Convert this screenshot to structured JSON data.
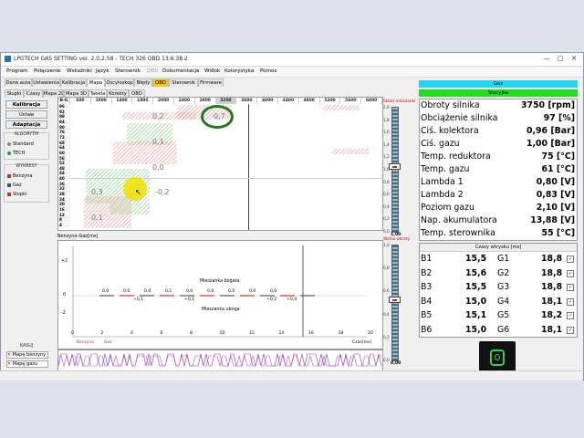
{
  "window": {
    "title": "LPGTECH GAS SETTING ver. 2.0.2.58 - TECH 326 OBD 13.6.38.2",
    "controls": [
      "—",
      "□",
      "✕"
    ]
  },
  "menu": [
    "Program",
    "Połączenie",
    "Wskaźniki",
    "Język",
    "Sterownik",
    "OBD",
    "Dokumentacja",
    "Widok",
    "Kolorystyka",
    "Pomoc"
  ],
  "tabs_top": [
    "Dane auta",
    "Ustawienia",
    "Kalibracja",
    "Mapa",
    "Oscyloskop",
    "Błędy",
    "OBD",
    "Sterownik",
    "Firmware"
  ],
  "tabs_sub": [
    "Słupki",
    "Czasy",
    "Mapa 2D",
    "Mapa 3D",
    "Tabela",
    "Korekty",
    "OBD"
  ],
  "left": {
    "buttons": [
      "Kalibracja",
      "Ustaw",
      "Adaptacja"
    ],
    "algorytm": {
      "caption": "ALGORYTM",
      "options": [
        "Standard",
        "TECH"
      ]
    },
    "wykresy": {
      "caption": "WYKRESY",
      "options": [
        "Benzyna",
        "Gaz",
        "Słupki"
      ]
    },
    "kasuj": {
      "caption": "KASUJ",
      "options": [
        "Mapę benzyny",
        "Mapę gazu"
      ]
    }
  },
  "map": {
    "corner": "B-G",
    "columns": [
      "600",
      "1000",
      "1400",
      "1800",
      "2000",
      "2400",
      "2800",
      "3200",
      "3600",
      "4000",
      "4400",
      "4800",
      "5200",
      "5600",
      "6000"
    ],
    "rows": [
      "96",
      "92",
      "88",
      "84",
      "80",
      "76",
      "72",
      "68",
      "64",
      "60",
      "56",
      "52",
      "48",
      "44",
      "40",
      "36",
      "32",
      "28",
      "24",
      "20",
      "16",
      "12",
      "8",
      "4"
    ],
    "values": [
      "0,2",
      "0,7",
      "0,1",
      "0,0",
      "0,3",
      "-0,2",
      "0,1"
    ]
  },
  "slider1": {
    "caption": "Skład mieszanki",
    "ticks": [
      "2,0",
      "1,8",
      "1,6",
      "1,4",
      "1,2",
      "1,0",
      "0,8",
      "0,6",
      "0,4",
      "0,2",
      "0,0"
    ],
    "value": "1,00"
  },
  "slider2": {
    "caption": "Wolne obroty",
    "ticks": [
      "1,0",
      "0,8",
      "0,6",
      "0,4",
      "0,2",
      "0,0"
    ],
    "value": "0,00"
  },
  "graph": {
    "title": "Benzyna-Gaz[ms]",
    "yticks": [
      "+2",
      "0",
      "-2"
    ],
    "xticks": [
      "0",
      "2",
      "4",
      "6",
      "8",
      "10",
      "12",
      "14",
      "16",
      "18",
      "20"
    ],
    "xlabel": "Czas[ms]",
    "rich": "Mieszanka bogata",
    "lean": "Mieszanka uboga",
    "labels_top": [
      "0,0",
      "0,0",
      "0,0",
      "0,1",
      "0,0",
      "0,0",
      "0,0",
      "0,0",
      "0,0"
    ],
    "labels_bot": [
      "+0,1",
      "+0,1",
      "+0,2",
      "+0,4"
    ],
    "legend": [
      "Benzyna",
      "Gaz"
    ]
  },
  "right": {
    "gaz_label": "Gaz",
    "status_label": "Stacyjka",
    "params": [
      {
        "label": "Obroty silnika",
        "value": "3750 [rpm]"
      },
      {
        "label": "Obciążenie silnika",
        "value": "97 [%]"
      },
      {
        "label": "Ciś. kolektora",
        "value": "0,96 [Bar]"
      },
      {
        "label": "Ciś. gazu",
        "value": "1,00 [Bar]"
      },
      {
        "label": "Temp. reduktora",
        "value": "75 [°C]"
      },
      {
        "label": "Temp. gazu",
        "value": "61 [°C]"
      },
      {
        "label": "Lambda 1",
        "value": "0,80 [V]"
      },
      {
        "label": "Lambda 2",
        "value": "0,83 [V]"
      },
      {
        "label": "Poziom gazu",
        "value": "2,10 [V]"
      },
      {
        "label": "Nap. akumulatora",
        "value": "13,88 [V]"
      },
      {
        "label": "Temp. sterownika",
        "value": "55 [°C]"
      }
    ],
    "injectors_title": "Czasy wtrysku [ms]",
    "injectors": [
      {
        "b": "B1",
        "bv": "15,5",
        "g": "G1",
        "gv": "18,8"
      },
      {
        "b": "B2",
        "bv": "15,6",
        "g": "G2",
        "gv": "18,8"
      },
      {
        "b": "B3",
        "bv": "15,5",
        "g": "G3",
        "gv": "18,8"
      },
      {
        "b": "B4",
        "bv": "15,0",
        "g": "G4",
        "gv": "18,1"
      },
      {
        "b": "B5",
        "bv": "15,1",
        "g": "G5",
        "gv": "18,2"
      },
      {
        "b": "B6",
        "bv": "15,0",
        "g": "G6",
        "gv": "18,1"
      }
    ],
    "checkmark": "✓"
  },
  "colors": {
    "accent_cyan": "#23d6f0",
    "status_green": "#22dd22",
    "highlight_circle": "#1e7a1e",
    "cursor": "#f2e10d",
    "benzyna": "#c0392b",
    "gaz": "#2e4fb0"
  }
}
